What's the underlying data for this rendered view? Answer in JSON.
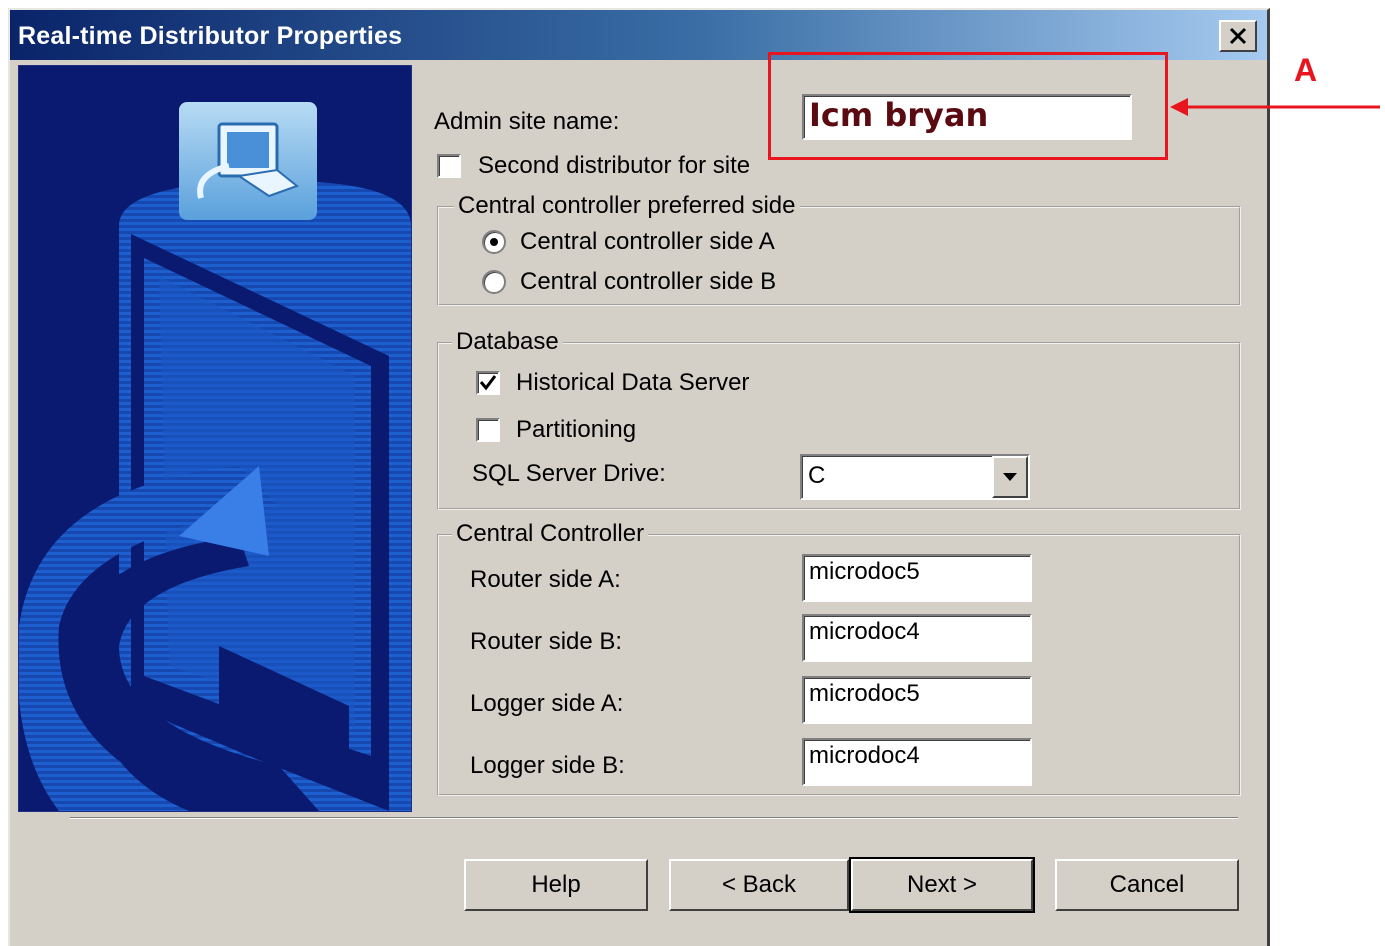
{
  "window": {
    "title": "Real-time Distributor Properties"
  },
  "fields": {
    "admin_site_name_label": "Admin site name:",
    "admin_site_name_value": "Icm bryan",
    "second_distributor_label": "Second distributor for site",
    "second_distributor_checked": false
  },
  "central_controller_side": {
    "title": "Central controller preferred side",
    "options": [
      {
        "label": "Central controller side A",
        "selected": true
      },
      {
        "label": "Central controller side B",
        "selected": false
      }
    ]
  },
  "database": {
    "title": "Database",
    "historical_label": "Historical Data Server",
    "historical_checked": true,
    "partitioning_label": "Partitioning",
    "partitioning_checked": false,
    "sql_drive_label": "SQL Server Drive:",
    "sql_drive_value": "C"
  },
  "central_controller": {
    "title": "Central Controller",
    "router_a_label": "Router side A:",
    "router_a_value": "microdoc5",
    "router_b_label": "Router side B:",
    "router_b_value": "microdoc4",
    "logger_a_label": "Logger side A:",
    "logger_a_value": "microdoc5",
    "logger_b_label": "Logger side B:",
    "logger_b_value": "microdoc4"
  },
  "buttons": {
    "help": "Help",
    "back": "< Back",
    "next": "Next >",
    "cancel": "Cancel"
  },
  "callout": {
    "letter": "A",
    "color": "#e8141e"
  },
  "icons": [
    "close-icon",
    "dropdown-arrow-icon",
    "setup-computer-icon",
    "checkmark-icon"
  ]
}
